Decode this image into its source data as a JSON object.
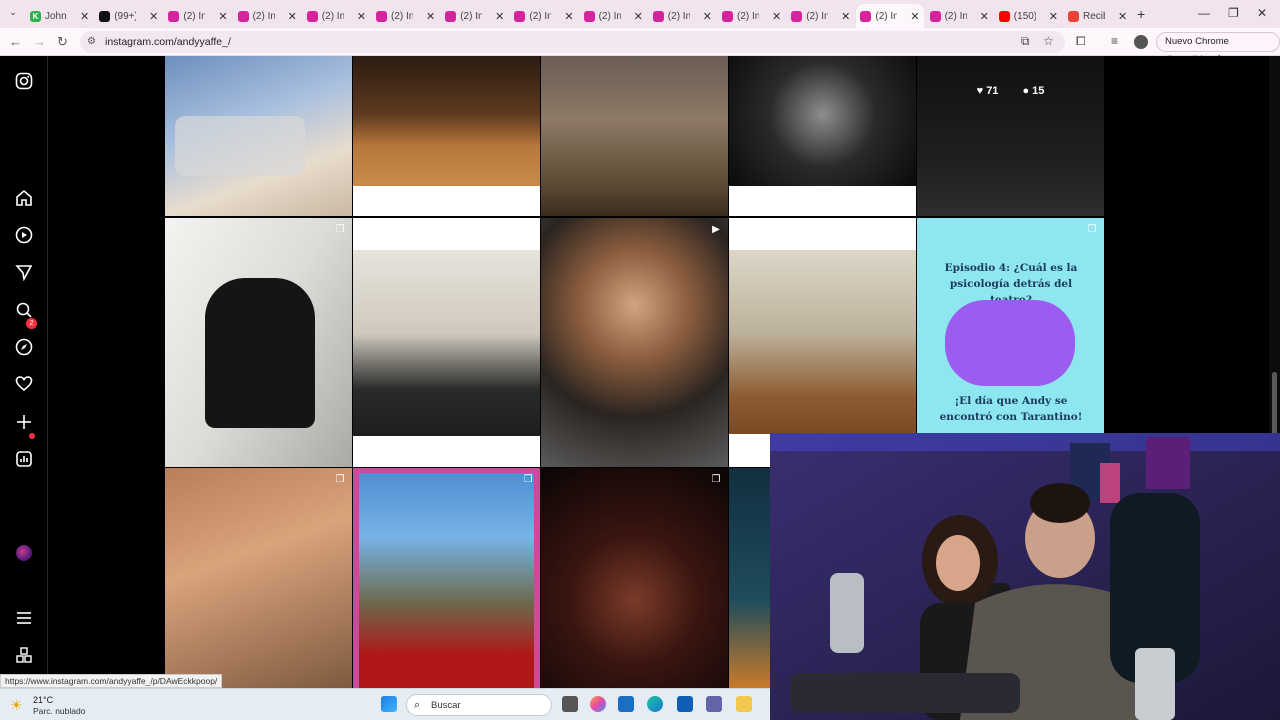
{
  "browser": {
    "tabs": [
      {
        "label": "Johnn",
        "favicon": "K",
        "favicon_color": "#2bb34a"
      },
      {
        "label": "(99+)",
        "favicon": "tiktok-icon",
        "favicon_color": "#111111"
      },
      {
        "label": "(2) Ins",
        "favicon": "instagram-icon",
        "favicon_color": "#d6249f"
      },
      {
        "label": "(2) Ins",
        "favicon": "instagram-icon",
        "favicon_color": "#d6249f"
      },
      {
        "label": "(2) Ins",
        "favicon": "instagram-icon",
        "favicon_color": "#d6249f"
      },
      {
        "label": "(2) Ins",
        "favicon": "instagram-icon",
        "favicon_color": "#d6249f"
      },
      {
        "label": "(2) Ins",
        "favicon": "instagram-icon",
        "favicon_color": "#d6249f"
      },
      {
        "label": "(2) Ins",
        "favicon": "instagram-icon",
        "favicon_color": "#d6249f"
      },
      {
        "label": "(2) Ins",
        "favicon": "instagram-icon",
        "favicon_color": "#d6249f"
      },
      {
        "label": "(2) Ins",
        "favicon": "instagram-icon",
        "favicon_color": "#d6249f"
      },
      {
        "label": "(2) Ins",
        "favicon": "instagram-icon",
        "favicon_color": "#d6249f"
      },
      {
        "label": "(2) Ins",
        "favicon": "instagram-icon",
        "favicon_color": "#d6249f"
      },
      {
        "label": "(2) Ins",
        "favicon": "instagram-icon",
        "favicon_color": "#d6249f",
        "active": true
      },
      {
        "label": "(2) Ins",
        "favicon": "instagram-icon",
        "favicon_color": "#d6249f"
      },
      {
        "label": "(150)",
        "favicon": "youtube-icon",
        "favicon_color": "#ff0000"
      },
      {
        "label": "Recib",
        "favicon": "gmail-icon",
        "favicon_color": "#ea4335"
      }
    ],
    "url": "instagram.com/andyyaffe_/",
    "update_label": "Nuevo Chrome disponible",
    "status_url": "https://www.instagram.com/andyyaffe_/p/DAwEckkpoop/"
  },
  "instagram": {
    "notification_count": "2",
    "hover_likes": "71",
    "hover_comments": "15",
    "episode_card": {
      "title": "Episodio 4: ¿Cuál es la psicología detrás del teatro?",
      "caption": "¡El día que Andy se encontró con Tarantino!",
      "bg_color": "#8ee6f0"
    }
  },
  "taskbar": {
    "weather_temp": "21°C",
    "weather_desc": "Parc. nublado",
    "search_label": "Buscar"
  }
}
